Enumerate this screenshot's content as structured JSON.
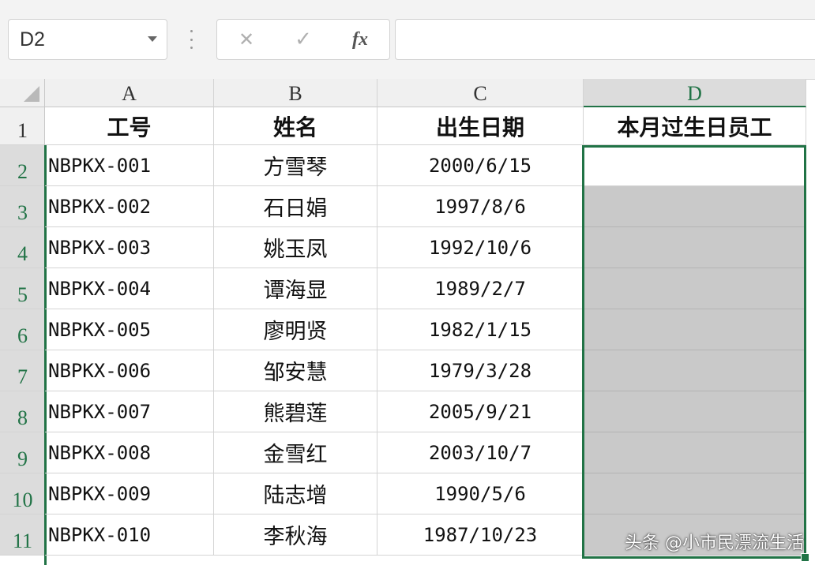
{
  "formula_bar": {
    "name_box": "D2",
    "cancel_glyph": "✕",
    "confirm_glyph": "✓",
    "fx_label": "fx",
    "formula_value": ""
  },
  "sheet": {
    "columns": [
      "A",
      "B",
      "C",
      "D"
    ],
    "rows": [
      "1",
      "2",
      "3",
      "4",
      "5",
      "6",
      "7",
      "8",
      "9",
      "10",
      "11"
    ],
    "selected_column": "D",
    "selected_range": "D2:D11",
    "active_cell": "D2",
    "headers": [
      "工号",
      "姓名",
      "出生日期",
      "本月过生日员工"
    ],
    "records": [
      {
        "id": "NBPKX-001",
        "name": "方雪琴",
        "birth": "2000/6/15",
        "flag": ""
      },
      {
        "id": "NBPKX-002",
        "name": "石日娟",
        "birth": "1997/8/6",
        "flag": ""
      },
      {
        "id": "NBPKX-003",
        "name": "姚玉凤",
        "birth": "1992/10/6",
        "flag": ""
      },
      {
        "id": "NBPKX-004",
        "name": "谭海显",
        "birth": "1989/2/7",
        "flag": ""
      },
      {
        "id": "NBPKX-005",
        "name": "廖明贤",
        "birth": "1982/1/15",
        "flag": ""
      },
      {
        "id": "NBPKX-006",
        "name": "邹安慧",
        "birth": "1979/3/28",
        "flag": ""
      },
      {
        "id": "NBPKX-007",
        "name": "熊碧莲",
        "birth": "2005/9/21",
        "flag": ""
      },
      {
        "id": "NBPKX-008",
        "name": "金雪红",
        "birth": "2003/10/7",
        "flag": ""
      },
      {
        "id": "NBPKX-009",
        "name": "陆志增",
        "birth": "1990/5/6",
        "flag": ""
      },
      {
        "id": "NBPKX-010",
        "name": "李秋海",
        "birth": "1987/10/23",
        "flag": ""
      }
    ]
  },
  "watermark": "头条 @小市民漂流生活",
  "colors": {
    "accent": "#217346",
    "selection_fill": "#c9c9c9",
    "header_bg": "#f0f0f0"
  }
}
